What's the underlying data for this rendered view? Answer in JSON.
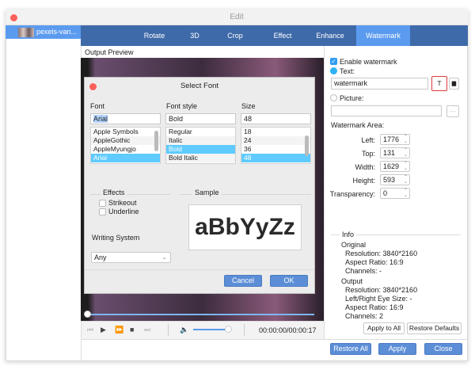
{
  "window": {
    "title": "Edit"
  },
  "sidebar": {
    "items": [
      {
        "label": "pexels-van..."
      }
    ]
  },
  "tabs": [
    {
      "label": "Rotate"
    },
    {
      "label": "3D"
    },
    {
      "label": "Crop"
    },
    {
      "label": "Effect"
    },
    {
      "label": "Enhance"
    },
    {
      "label": "Watermark",
      "active": true
    }
  ],
  "preview": {
    "label": "Output Preview",
    "time": "00:00:00/00:00:17",
    "progress": 0,
    "volume": 0.9
  },
  "font_dialog": {
    "title": "Select Font",
    "font": {
      "label": "Font",
      "value": "Arial",
      "options": [
        "Apple Symbols",
        "AppleGothic",
        "AppleMyungjo",
        "Arial"
      ],
      "selected": "Arial"
    },
    "style": {
      "label": "Font style",
      "value": "Bold",
      "options": [
        "Regular",
        "Italic",
        "Bold",
        "Bold Italic"
      ],
      "selected": "Bold"
    },
    "size": {
      "label": "Size",
      "value": "48",
      "options": [
        "18",
        "24",
        "36",
        "48"
      ],
      "selected": "48"
    },
    "effects": {
      "label": "Effects",
      "strikeout": "Strikeout",
      "underline": "Underline",
      "strikeout_checked": false,
      "underline_checked": false
    },
    "sample": {
      "label": "Sample",
      "text": "aBbYyZz"
    },
    "writing_system": {
      "label": "Writing System",
      "value": "Any"
    },
    "cancel": "Cancel",
    "ok": "OK"
  },
  "watermark": {
    "enable_label": "Enable watermark",
    "enabled": true,
    "text_label": "Text:",
    "text_value": "watermark",
    "picture_label": "Picture:",
    "picture_value": "",
    "browse": "···",
    "area_label": "Watermark Area:",
    "fields": [
      {
        "label": "Left:",
        "value": "1776"
      },
      {
        "label": "Top:",
        "value": "131"
      },
      {
        "label": "Width:",
        "value": "1629"
      },
      {
        "label": "Height:",
        "value": "593"
      },
      {
        "label": "Transparency:",
        "value": "0"
      }
    ]
  },
  "info": {
    "label": "Info",
    "original": {
      "label": "Original",
      "lines": [
        "Resolution: 3840*2160",
        "Aspect Ratio: 16:9",
        "Channels: -"
      ]
    },
    "output": {
      "label": "Output",
      "lines": [
        "Resolution: 3840*2160",
        "Left/Right Eye Size: -",
        "Aspect Ratio: 16:9",
        "Channels: 2"
      ]
    }
  },
  "buttons": {
    "apply_all": "Apply to All",
    "restore_defaults": "Restore Defaults",
    "restore_all": "Restore All",
    "apply": "Apply",
    "close": "Close"
  },
  "colors": {
    "tabbar": "#3f6aa9",
    "active_tab": "#5b9bef",
    "selection": "#5fcbff",
    "button": "#5b8ed6",
    "highlight_border": "#e0393b"
  }
}
